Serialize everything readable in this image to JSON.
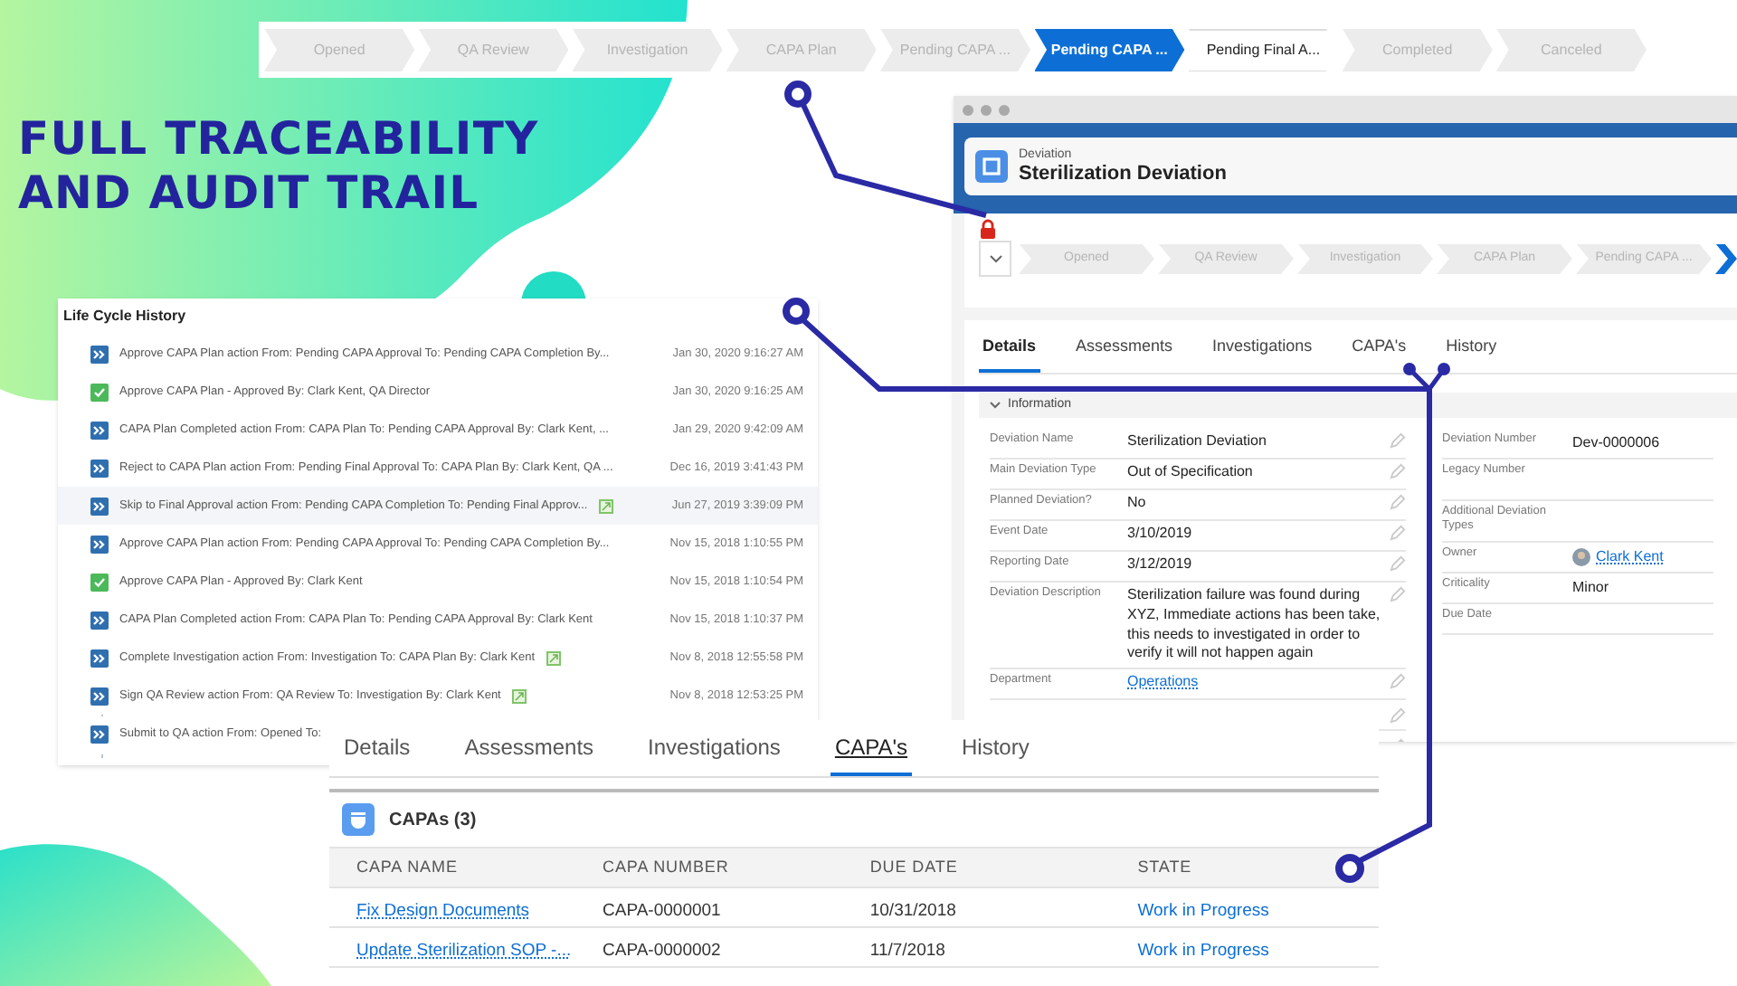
{
  "headline": [
    "FULL TRACEABILITY",
    "AND AUDIT TRAIL"
  ],
  "top_path": [
    {
      "label": "Opened",
      "kind": "past"
    },
    {
      "label": "QA Review",
      "kind": "past"
    },
    {
      "label": "Investigation",
      "kind": "past"
    },
    {
      "label": "CAPA Plan",
      "kind": "past"
    },
    {
      "label": "Pending CAPA ...",
      "kind": "past"
    },
    {
      "label": "Pending CAPA ...",
      "kind": "current"
    },
    {
      "label": "Pending Final A...",
      "kind": "open"
    },
    {
      "label": "Completed",
      "kind": "past"
    },
    {
      "label": "Canceled",
      "kind": "past"
    }
  ],
  "deviation_window": {
    "object_type": "Deviation",
    "title": "Sterilization Deviation",
    "path": [
      {
        "label": "Opened",
        "kind": "past"
      },
      {
        "label": "QA Review",
        "kind": "past"
      },
      {
        "label": "Investigation",
        "kind": "past"
      },
      {
        "label": "CAPA Plan",
        "kind": "past"
      },
      {
        "label": "Pending CAPA ...",
        "kind": "past"
      },
      {
        "kind": "current"
      }
    ],
    "tabs": [
      {
        "label": "Details",
        "selected": true
      },
      {
        "label": "Assessments",
        "selected": false
      },
      {
        "label": "Investigations",
        "selected": false
      },
      {
        "label": "CAPA's",
        "selected": false
      },
      {
        "label": "History",
        "selected": false
      }
    ],
    "section": "Information",
    "left_fields": [
      {
        "label": "Deviation Name",
        "value": "Sterilization Deviation",
        "kind": "text"
      },
      {
        "label": "Main Deviation Type",
        "value": "Out of Specification",
        "kind": "text"
      },
      {
        "label": "Planned Deviation?",
        "value": "No",
        "kind": "text"
      },
      {
        "label": "Event Date",
        "value": "3/10/2019",
        "kind": "text"
      },
      {
        "label": "Reporting Date",
        "value": "3/12/2019",
        "kind": "text"
      },
      {
        "label": "Deviation Description",
        "value": "Sterilization failure was found during XYZ, Immediate actions has been take, this needs to investigated in order to verify it will not happen again",
        "kind": "text"
      },
      {
        "label": "Department",
        "value": "Operations",
        "kind": "link"
      }
    ],
    "right_fields": [
      {
        "label": "Deviation Number",
        "value": "Dev-0000006",
        "kind": "text"
      },
      {
        "label": "Legacy Number",
        "kind": "empty"
      },
      {
        "label": "Additional Deviation Types",
        "kind": "empty"
      },
      {
        "label": "Owner",
        "value": "Clark Kent",
        "kind": "user"
      },
      {
        "label": "Criticality",
        "value": "Minor",
        "kind": "text"
      },
      {
        "label": "Due Date",
        "kind": "empty"
      }
    ]
  },
  "life_cycle_history": {
    "title": "Life Cycle History",
    "entries": [
      {
        "kind": "action",
        "text": "Approve CAPA Plan action From: Pending CAPA Approval To: Pending CAPA Completion By...",
        "date": "Jan 30, 2020 9:16:27 AM",
        "attachment": false,
        "selected": false
      },
      {
        "kind": "approval",
        "text": "Approve CAPA Plan - Approved By: Clark Kent, QA Director",
        "date": "Jan 30, 2020 9:16:25 AM",
        "attachment": false,
        "selected": false
      },
      {
        "kind": "action",
        "text": "CAPA Plan Completed action From: CAPA Plan To: Pending CAPA Approval By: Clark Kent, ...",
        "date": "Jan 29, 2020 9:42:09 AM",
        "attachment": false,
        "selected": false
      },
      {
        "kind": "action",
        "text": "Reject to CAPA Plan action From: Pending Final Approval To: CAPA Plan By: Clark Kent, QA ...",
        "date": "Dec 16, 2019 3:41:43 PM",
        "attachment": false,
        "selected": false
      },
      {
        "kind": "action",
        "text": "Skip to Final Approval action From: Pending CAPA Completion To: Pending Final Approv...",
        "date": "Jun 27, 2019 3:39:09 PM",
        "attachment": true,
        "selected": true
      },
      {
        "kind": "action",
        "text": "Approve CAPA Plan action From: Pending CAPA Approval To: Pending CAPA Completion By...",
        "date": "Nov 15, 2018 1:10:55 PM",
        "attachment": false,
        "selected": false
      },
      {
        "kind": "approval",
        "text": "Approve CAPA Plan - Approved By: Clark Kent",
        "date": "Nov 15, 2018 1:10:54 PM",
        "attachment": false,
        "selected": false
      },
      {
        "kind": "action",
        "text": "CAPA Plan Completed action From: CAPA Plan To: Pending CAPA Approval By: Clark Kent",
        "date": "Nov 15, 2018 1:10:37 PM",
        "attachment": false,
        "selected": false
      },
      {
        "kind": "action",
        "text": "Complete Investigation action From: Investigation To: CAPA Plan By: Clark Kent",
        "date": "Nov 8, 2018 12:55:58 PM",
        "attachment": true,
        "selected": false
      },
      {
        "kind": "action",
        "text": "Sign QA Review action From: QA Review To: Investigation By: Clark Kent",
        "date": "Nov 8, 2018 12:53:25 PM",
        "attachment": true,
        "selected": false
      },
      {
        "kind": "action",
        "text": "Submit to QA action From: Opened To:",
        "attachment": false,
        "selected": false
      }
    ]
  },
  "capa_panel": {
    "tabs": [
      {
        "label": "Details",
        "selected": false
      },
      {
        "label": "Assessments",
        "selected": false
      },
      {
        "label": "Investigations",
        "selected": false
      },
      {
        "label": "CAPA's",
        "selected": true
      },
      {
        "label": "History",
        "selected": false
      }
    ],
    "title": "CAPAs (3)",
    "columns": [
      "CAPA NAME",
      "CAPA NUMBER",
      "DUE DATE",
      "STATE"
    ],
    "rows": [
      [
        "Fix Design Documents",
        "CAPA-0000001",
        "10/31/2018",
        "Work in Progress"
      ],
      [
        "Update Sterilization SOP -...",
        "CAPA-0000002",
        "11/7/2018",
        "Work in Progress"
      ]
    ]
  }
}
